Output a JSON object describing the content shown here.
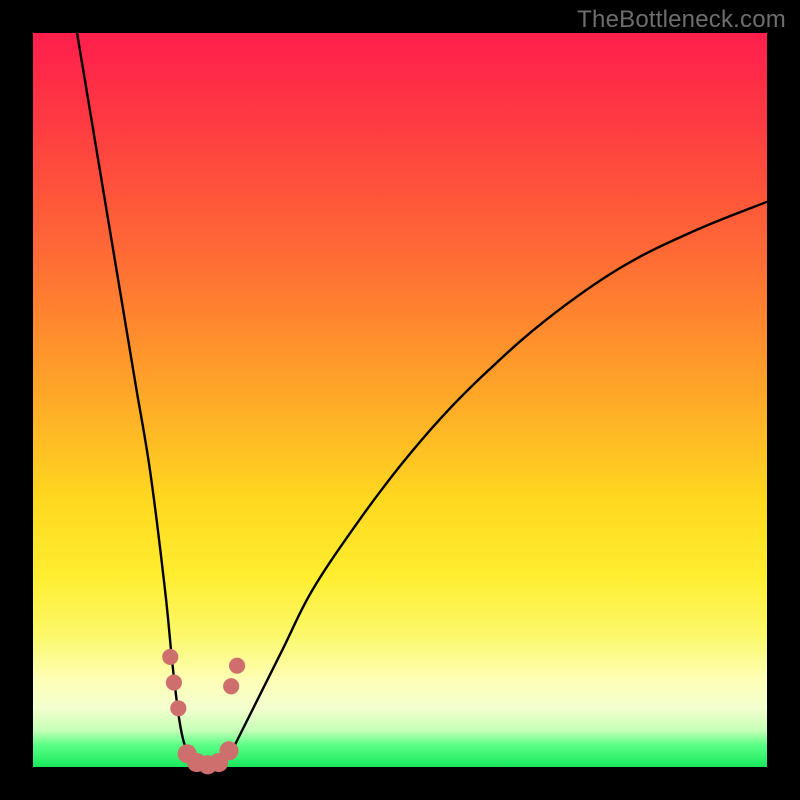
{
  "watermark": "TheBottleneck.com",
  "chart_data": {
    "type": "line",
    "title": "",
    "xlabel": "",
    "ylabel": "",
    "xlim": [
      0,
      100
    ],
    "ylim": [
      0,
      100
    ],
    "series": [
      {
        "name": "bottleneck-curve",
        "x": [
          6,
          8,
          10,
          12,
          14,
          16,
          18,
          19,
          20,
          21,
          22,
          23,
          24,
          25,
          26,
          27,
          28,
          30,
          34,
          38,
          44,
          50,
          56,
          62,
          70,
          80,
          90,
          100
        ],
        "y": [
          100,
          88,
          76,
          64,
          52,
          40,
          24,
          14,
          6,
          2,
          0.5,
          0,
          0,
          0,
          0.5,
          2,
          4,
          8,
          16,
          24,
          33,
          41,
          48,
          54,
          61,
          68,
          73,
          77
        ]
      }
    ],
    "markers": {
      "name": "highlighted-points",
      "color": "#cf6f6d",
      "points": [
        {
          "x": 18.7,
          "y": 15.0,
          "r": 1.1
        },
        {
          "x": 19.2,
          "y": 11.5,
          "r": 1.1
        },
        {
          "x": 19.8,
          "y": 8.0,
          "r": 1.1
        },
        {
          "x": 21.0,
          "y": 1.8,
          "r": 1.3
        },
        {
          "x": 22.3,
          "y": 0.6,
          "r": 1.3
        },
        {
          "x": 23.8,
          "y": 0.3,
          "r": 1.3
        },
        {
          "x": 25.3,
          "y": 0.6,
          "r": 1.3
        },
        {
          "x": 26.7,
          "y": 2.2,
          "r": 1.3
        },
        {
          "x": 27.0,
          "y": 11.0,
          "r": 1.1
        },
        {
          "x": 27.8,
          "y": 13.8,
          "r": 1.1
        }
      ]
    }
  }
}
